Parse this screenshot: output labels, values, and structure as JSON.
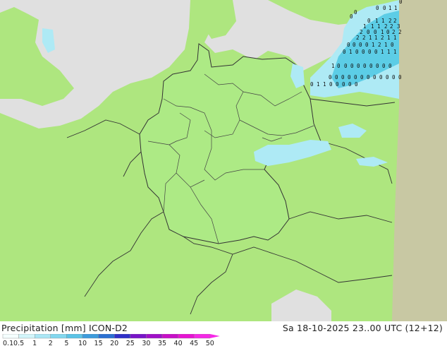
{
  "footer": {
    "left_title": "Precipitation [mm]  ICON-D2",
    "right_title": "Sa 18-10-2025 23..00 UTC (12+12)"
  },
  "legend": {
    "labels": [
      "0.1",
      "0.5",
      "1",
      "2",
      "5",
      "10",
      "15",
      "20",
      "25",
      "30",
      "35",
      "40",
      "45",
      "50"
    ],
    "colors": [
      "#f5ffff",
      "#d2f5fa",
      "#aae6f5",
      "#82d7ee",
      "#5ac3e6",
      "#3c9bdc",
      "#2a6fd2",
      "#2f2fc8",
      "#7814c8",
      "#a00fc8",
      "#c80fc8",
      "#e614d2",
      "#f528e6"
    ]
  },
  "colors": {
    "land_inside": "#adea85",
    "land_outside": "#aee67f",
    "sea_grey": "#e0e0e0",
    "out_of_domain": "#c8c8a3",
    "precip_light": "#aeeaf5",
    "precip_medium": "#5ccde6",
    "border": "#333333"
  },
  "precip_labels": [
    "0",
    "0",
    "1",
    "1",
    "0",
    "0",
    "0",
    "0",
    "1",
    "1",
    "2",
    "2",
    "1",
    "1",
    "1",
    "2",
    "2",
    "3",
    "2",
    "0",
    "0",
    "1",
    "0",
    "2",
    "2",
    "2",
    "2",
    "1",
    "1",
    "2",
    "1",
    "1",
    "0",
    "0",
    "0",
    "0",
    "1",
    "2",
    "1",
    "0",
    "0",
    "1",
    "0",
    "0",
    "0",
    "0",
    "1",
    "1",
    "1",
    "1",
    "0",
    "0",
    "0",
    "0",
    "0",
    "0",
    "0",
    "0",
    "0",
    "0",
    "0",
    "0",
    "0",
    "0",
    "0",
    "0",
    "0",
    "0",
    "0",
    "0",
    "0",
    "0",
    "1",
    "1",
    "0",
    "0",
    "0",
    "0",
    "0",
    "0"
  ]
}
